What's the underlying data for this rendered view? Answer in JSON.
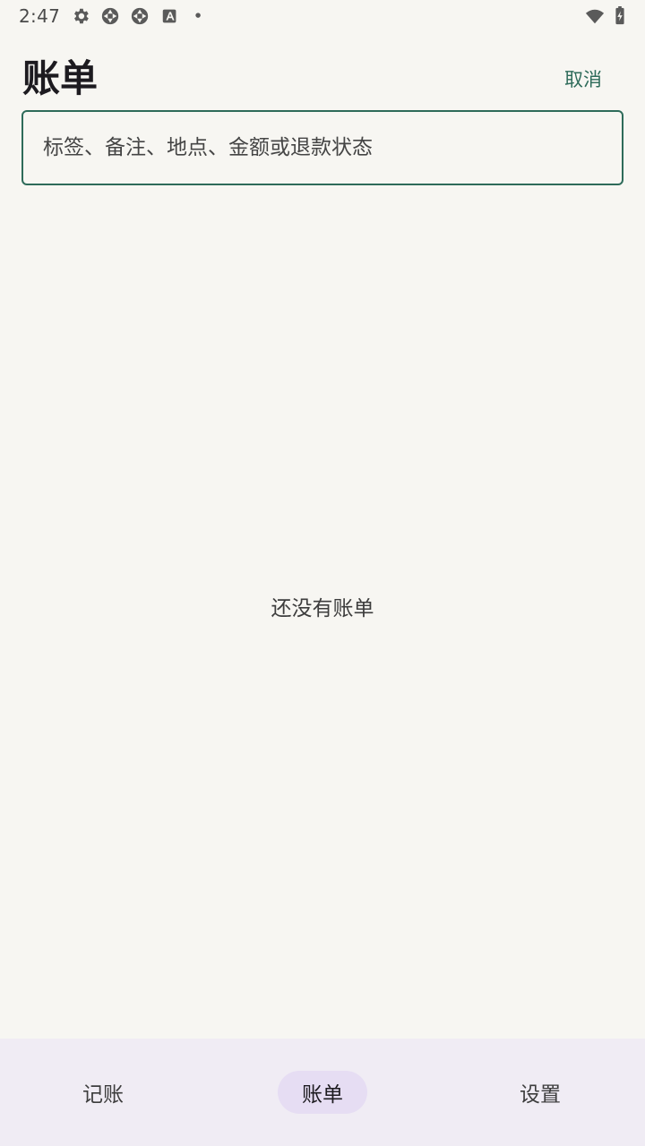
{
  "status_bar": {
    "time": "2:47",
    "icons": [
      "gear-icon",
      "app-icon",
      "app-icon",
      "font-icon",
      "dot-icon",
      "wifi-icon",
      "battery-charging-icon"
    ]
  },
  "header": {
    "title": "账单",
    "cancel_label": "取消"
  },
  "search": {
    "placeholder": "标签、备注、地点、金额或退款状态",
    "value": ""
  },
  "main": {
    "empty_message": "还没有账单"
  },
  "bottom_nav": {
    "items": [
      {
        "label": "记账",
        "active": false
      },
      {
        "label": "账单",
        "active": true
      },
      {
        "label": "设置",
        "active": false
      }
    ]
  },
  "colors": {
    "accent": "#2e6b5a",
    "background": "#f7f6f2",
    "nav_background": "#f0ecf4",
    "nav_active": "#e6ddf3"
  }
}
